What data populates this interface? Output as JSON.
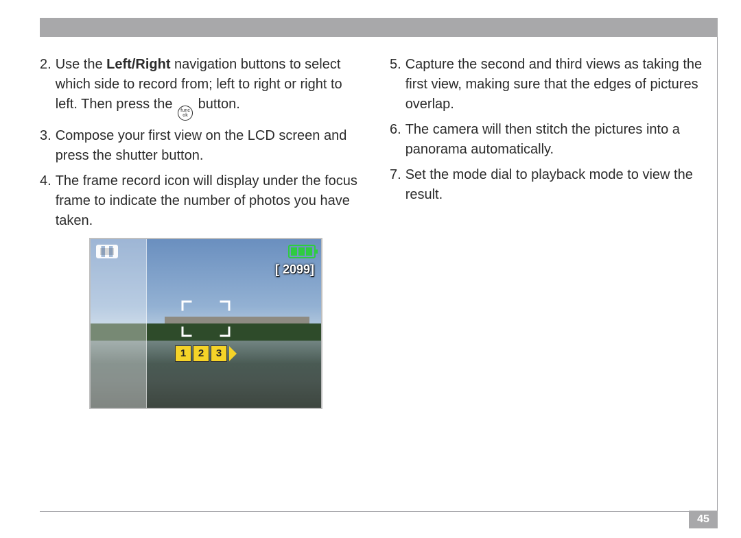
{
  "page_number": "45",
  "left": {
    "step2": {
      "num": "2.",
      "pre": "Use the ",
      "bold": "Left/Right",
      "post1": " navigation buttons to select which side to record from; left to right or right to left. Then press the ",
      "post2": " button."
    },
    "step3": {
      "num": "3.",
      "text": "Compose your first view on the LCD screen and press the shutter button."
    },
    "step4": {
      "num": "4.",
      "text": "The frame record icon will display under the focus frame to indicate the number of photos you have taken."
    }
  },
  "right": {
    "step5": {
      "num": "5.",
      "text": "Capture the second and third views as taking the first view, making sure that the edges of pictures overlap."
    },
    "step6": {
      "num": "6.",
      "text": "The camera will then stitch the pictures into a panorama automatically."
    },
    "step7": {
      "num": "7.",
      "text": "Set the mode dial to playback mode to view the result."
    }
  },
  "lcd": {
    "counter_label": "[  2099]",
    "frames": [
      "1",
      "2",
      "3"
    ]
  },
  "func_icon": {
    "top": "func",
    "bottom": "ok"
  }
}
